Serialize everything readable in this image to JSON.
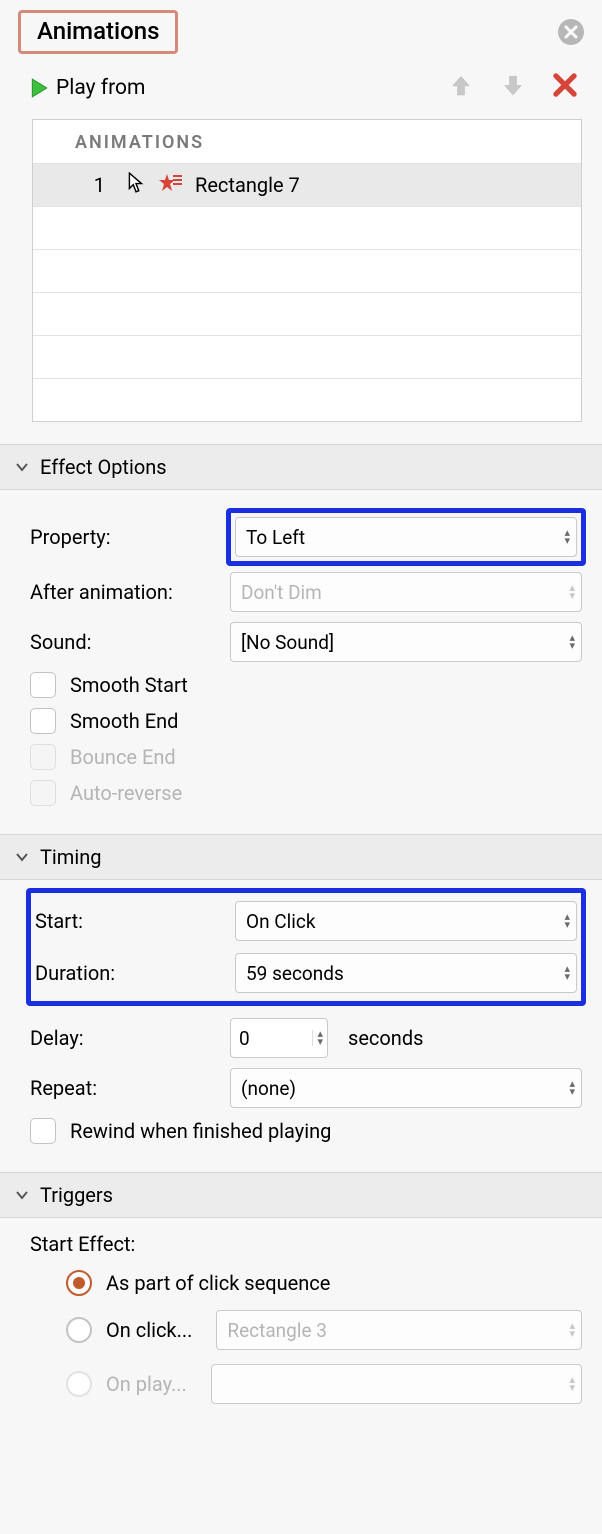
{
  "tab_label": "Animations",
  "toolbar": {
    "play_label": "Play from"
  },
  "list": {
    "header": "ANIMATIONS",
    "items": [
      {
        "index": "1",
        "label": "Rectangle 7"
      }
    ]
  },
  "sections": {
    "effect": {
      "title": "Effect Options",
      "property_label": "Property:",
      "property_value": "To Left",
      "after_label": "After animation:",
      "after_value": "Don't Dim",
      "sound_label": "Sound:",
      "sound_value": "[No Sound]",
      "smooth_start": "Smooth Start",
      "smooth_end": "Smooth End",
      "bounce_end": "Bounce End",
      "auto_reverse": "Auto-reverse"
    },
    "timing": {
      "title": "Timing",
      "start_label": "Start:",
      "start_value": "On Click",
      "duration_label": "Duration:",
      "duration_value": "59 seconds",
      "delay_label": "Delay:",
      "delay_value": "0",
      "delay_unit": "seconds",
      "repeat_label": "Repeat:",
      "repeat_value": "(none)",
      "rewind": "Rewind when finished playing"
    },
    "triggers": {
      "title": "Triggers",
      "start_effect": "Start Effect:",
      "opt1": "As part of click sequence",
      "opt2": "On click...",
      "opt2_value": "Rectangle 3",
      "opt3": "On play..."
    }
  }
}
